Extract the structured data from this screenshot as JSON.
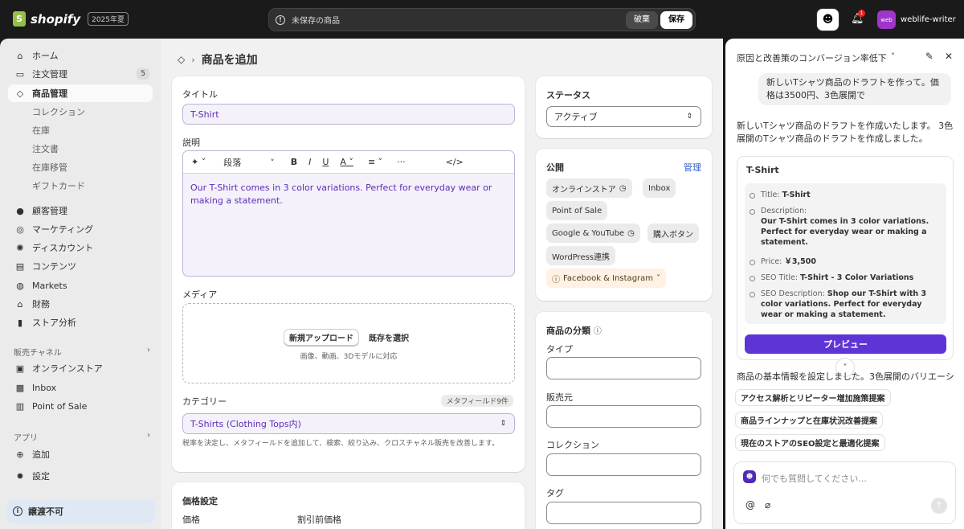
{
  "topbar": {
    "brand": "shopify",
    "edition": "2025年夏",
    "unsaved_label": "未保存の商品",
    "discard_label": "破棄",
    "save_label": "保存",
    "notification_count": "1",
    "avatar_text": "web",
    "store_name": "weblife-writer"
  },
  "sidebar": {
    "items": [
      {
        "label": "ホーム",
        "icon": "home-icon"
      },
      {
        "label": "注文管理",
        "icon": "inbox-icon",
        "count": "5"
      },
      {
        "label": "商品管理",
        "icon": "tag-icon",
        "active": true
      },
      {
        "label": "コレクション"
      },
      {
        "label": "在庫"
      },
      {
        "label": "注文書"
      },
      {
        "label": "在庫移管"
      },
      {
        "label": "ギフトカード"
      },
      {
        "label": "顧客管理",
        "icon": "person-icon"
      },
      {
        "label": "マーケティング",
        "icon": "target-icon"
      },
      {
        "label": "ディスカウント",
        "icon": "discount-icon"
      },
      {
        "label": "コンテンツ",
        "icon": "content-icon"
      },
      {
        "label": "Markets",
        "icon": "globe-icon"
      },
      {
        "label": "財務",
        "icon": "bank-icon"
      },
      {
        "label": "ストア分析",
        "icon": "chart-icon"
      }
    ],
    "sales_channels_heading": "販売チャネル",
    "channels": [
      {
        "label": "オンラインストア",
        "icon": "store-icon"
      },
      {
        "label": "Inbox",
        "icon": "inbox-app-icon"
      },
      {
        "label": "Point of Sale",
        "icon": "pos-icon"
      }
    ],
    "apps_heading": "アプリ",
    "add_label": "追加",
    "settings_label": "設定",
    "non_transferable_label": "譲渡不可"
  },
  "main": {
    "page_title": "商品を追加",
    "title_label": "タイトル",
    "title_value": "T-Shirt",
    "description_label": "説明",
    "editor_paragraph": "段落",
    "description_value": "Our T-Shirt comes in 3 color variations. Perfect for everyday wear or making a statement.",
    "media_label": "メディア",
    "upload_new": "新規アップロード",
    "select_existing": "既存を選択",
    "media_hint": "画像、動画、3Dモデルに対応",
    "category_label": "カテゴリー",
    "metafield_badge": "メタフィールド9件",
    "category_value": "T-Shirts (Clothing Tops内)",
    "category_note": "税率を決定し、メタフィールドを追加して、検索、絞り込み、クロスチャネル販売を改善します。",
    "pricing_heading": "価格設定",
    "price_label": "価格",
    "compare_price_label": "割引前価格"
  },
  "right_col": {
    "status_heading": "ステータス",
    "status_value": "アクティブ",
    "publishing_heading": "公開",
    "manage_link": "管理",
    "channels": [
      "オンラインストア",
      "Inbox",
      "Point of Sale",
      "Google & YouTube",
      "購入ボタン",
      "WordPress連携",
      "Facebook & Instagram"
    ],
    "organization_heading": "商品の分類",
    "type_label": "タイプ",
    "vendor_label": "販売元",
    "collections_label": "コレクション",
    "tags_label": "タグ"
  },
  "assistant": {
    "header_title": "原因と改善策のコンバージョン率低下",
    "user_message": "新しいTシャツ商品のドラフトを作って。価格は3500円、3色展開で",
    "reply": "新しいTシャツ商品のドラフトを作成いたします。 3色展開のTシャツ商品のドラフトを作成しました。",
    "card_title": "T-Shirt",
    "fields": {
      "title_key": "Title: ",
      "title_val": "T-Shirt",
      "desc_key": "Description:",
      "desc_val": "Our T-Shirt comes in 3 color variations. Perfect for everyday wear or making a statement.",
      "price_key": "Price: ",
      "price_val": "￥3,500",
      "seo_title_key": "SEO Title: ",
      "seo_title_val": "T-Shirt - 3 Color Variations",
      "seo_desc_key": "SEO Description: ",
      "seo_desc_val": "Shop our T-Shirt with 3 color variations. Perfect for everyday wear or making a statement."
    },
    "preview_button": "プレビュー",
    "continuation": "商品の基本情報を設定しました。3色展開のバリエーシ",
    "suggestions": [
      "アクセス解析とリピーター増加施策提案",
      "商品ラインナップと在庫状況改善提案",
      "現在のストアのSEO設定と最適化提案"
    ],
    "input_placeholder": "何でも質問してください..."
  },
  "colors": {
    "accent": "#5f34d6",
    "brand": "#95bf47",
    "topbar": "#1a1a1a"
  }
}
